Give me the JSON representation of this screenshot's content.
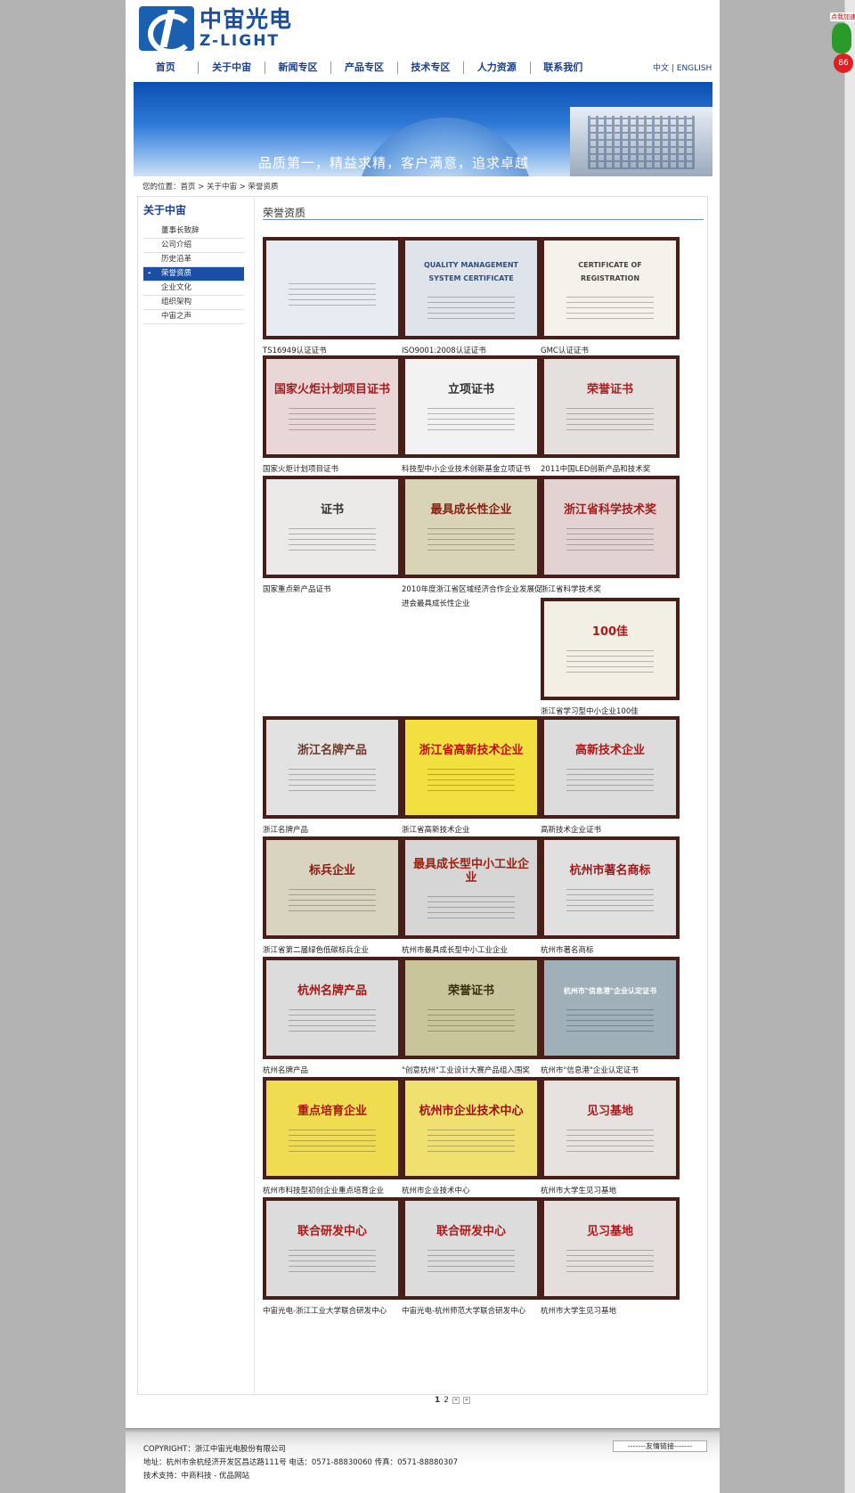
{
  "header": {
    "logo_cn": "中宙光电",
    "logo_en": "Z-LIGHT",
    "nav": [
      "首页",
      "关于中宙",
      "新闻专区",
      "产品专区",
      "技术专区",
      "人力资源",
      "联系我们"
    ],
    "lang": "中文 | ENGLISH",
    "slogan": "品质第一，精益求精，客户满意，追求卓越"
  },
  "breadcrumb": "您的位置：首页 > 关于中宙 > 荣誉资质",
  "sidebar": {
    "title": "关于中宙",
    "items": [
      "董事长致辞",
      "公司介绍",
      "历史沿革",
      "荣誉资质",
      "企业文化",
      "组织架构",
      "中宙之声"
    ],
    "active_index": 3
  },
  "main": {
    "title": "荣誉资质",
    "certificates": [
      {
        "caption": "TS16949认证证书",
        "heading": "",
        "bg": "#e8ecf2",
        "fg": "#3a5f9a"
      },
      {
        "caption": "ISO9001:2008认证证书",
        "heading": "QUALITY MANAGEMENT SYSTEM CERTIFICATE",
        "bg": "#dfe4ea",
        "fg": "#2f4f7f"
      },
      {
        "caption": "GMC认证证书",
        "heading": "CERTIFICATE OF REGISTRATION",
        "bg": "#f4f2ea",
        "fg": "#444444"
      },
      {
        "caption": "国家火炬计划项目证书",
        "heading": "国家火炬计划项目证书",
        "bg": "#e9d7d7",
        "fg": "#a02020"
      },
      {
        "caption": "科技型中小企业技术创新基金立项证书",
        "heading": "立项证书",
        "bg": "#f2f2f2",
        "fg": "#333333"
      },
      {
        "caption": "2011中国LED创新产品和技术奖",
        "heading": "荣誉证书",
        "bg": "#e4e0de",
        "fg": "#b02020"
      },
      {
        "caption": "国家重点新产品证书",
        "heading": "证书",
        "bg": "#eceae8",
        "fg": "#333333"
      },
      {
        "caption": "2010年度浙江省区域经济合作企业发展促进会最具成长性企业",
        "heading": "最具成长性企业",
        "bg": "#d9d4b8",
        "fg": "#8a2010"
      },
      {
        "caption": "浙江省科学技术奖",
        "heading": "浙江省科学技术奖",
        "bg": "#e2d2d2",
        "fg": "#a02020"
      },
      {
        "caption": "浙江省学习型中小企业100佳",
        "heading": "100佳",
        "bg": "#f2efe4",
        "fg": "#b01818"
      },
      {
        "caption": "浙江名牌产品",
        "heading": "浙江名牌产品",
        "bg": "#e2e2e2",
        "fg": "#6a3a2a"
      },
      {
        "caption": "浙江省高新技术企业",
        "heading": "浙江省高新技术企业",
        "bg": "#f2e040",
        "fg": "#c01010"
      },
      {
        "caption": "高新技术企业证书",
        "heading": "高新技术企业",
        "bg": "#dcdcdc",
        "fg": "#b01818"
      },
      {
        "caption": "浙江省第二届绿色低碳标兵企业",
        "heading": "标兵企业",
        "bg": "#d9d4c0",
        "fg": "#8a1a10"
      },
      {
        "caption": "杭州市最具成长型中小工业企业",
        "heading": "最具成长型中小工业企业",
        "bg": "#d6d6d6",
        "fg": "#9a2010"
      },
      {
        "caption": "杭州市著名商标",
        "heading": "杭州市著名商标",
        "bg": "#e0e0e0",
        "fg": "#a01818"
      },
      {
        "caption": "杭州名牌产品",
        "heading": "杭州名牌产品",
        "bg": "#dcdcdc",
        "fg": "#a01818"
      },
      {
        "caption": "\"创意杭州\"工业设计大赛产品组入围奖",
        "heading": "荣誉证书",
        "bg": "#c9c59a",
        "fg": "#3a3010"
      },
      {
        "caption": "杭州市\"信息港\"企业认定证书",
        "heading": "杭州市\"信息港\"企业认定证书",
        "bg": "#9fb0b8",
        "fg": "#ffffff"
      },
      {
        "caption": "杭州市科技型初创企业重点培育企业",
        "heading": "重点培育企业",
        "bg": "#f0dc50",
        "fg": "#b01010"
      },
      {
        "caption": "杭州市企业技术中心",
        "heading": "杭州市企业技术中心",
        "bg": "#f0e070",
        "fg": "#a01010"
      },
      {
        "caption": "杭州市大学生见习基地",
        "heading": "见习基地",
        "bg": "#e6e2e0",
        "fg": "#b01818"
      },
      {
        "caption": "中宙光电-浙江工业大学联合研发中心",
        "heading": "联合研发中心",
        "bg": "#dcdcdc",
        "fg": "#b01818"
      },
      {
        "caption": "中宙光电-杭州师范大学联合研发中心",
        "heading": "联合研发中心",
        "bg": "#dcdcdc",
        "fg": "#b01818"
      },
      {
        "caption": "杭州市大学生见习基地",
        "heading": "见习基地",
        "bg": "#e4dedc",
        "fg": "#b01818"
      }
    ]
  },
  "pager": {
    "current": "1",
    "next": "2",
    "arrow_next": "»",
    "arrow_last": "»"
  },
  "footer": {
    "copyright": "COPYRIGHT：浙江中宙光电股份有限公司",
    "address": "地址：杭州市余杭经济开发区昌达路111号 电话：0571-88830060 传真：0571-88880307",
    "support": "技术支持：中商科技 - 优品网站",
    "friend_links": "-------友情链接-------"
  },
  "widget": {
    "tag": "点我加速",
    "badge": "86"
  }
}
